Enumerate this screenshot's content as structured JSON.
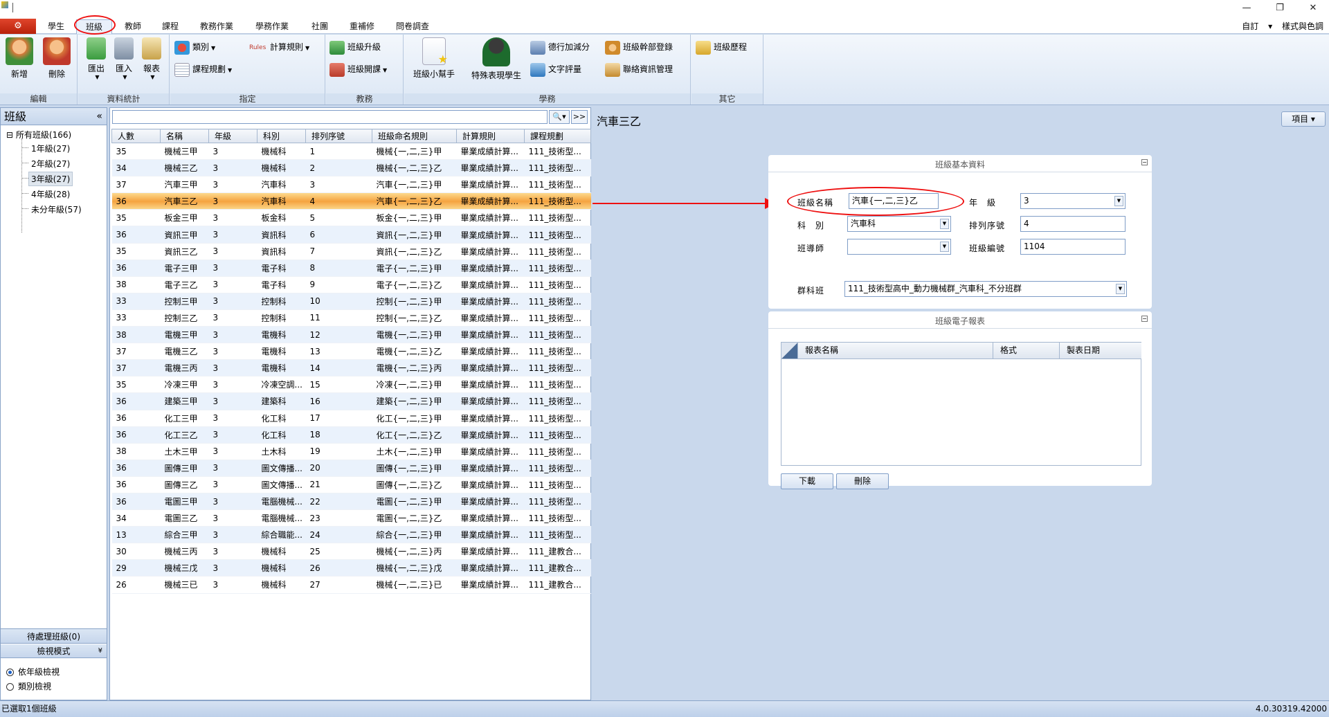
{
  "window": {
    "minimize": "—",
    "restore": "❐",
    "close": "✕"
  },
  "tabs": [
    {
      "label": "學生"
    },
    {
      "label": "班級"
    },
    {
      "label": "教師"
    },
    {
      "label": "課程"
    },
    {
      "label": "教務作業"
    },
    {
      "label": "學務作業"
    },
    {
      "label": "社團"
    },
    {
      "label": "重補修"
    },
    {
      "label": "問卷調查"
    }
  ],
  "top_right": {
    "customize": "自訂",
    "style": "樣式與色調"
  },
  "ribbon": {
    "groups": [
      {
        "label": "編輯"
      },
      {
        "label": "資料統計"
      },
      {
        "label": "指定"
      },
      {
        "label": "教務"
      },
      {
        "label": "學務"
      },
      {
        "label": "其它"
      }
    ],
    "add": "新增",
    "delete": "刪除",
    "export": "匯出",
    "import": "匯入",
    "report": "報表",
    "category": "類別",
    "calc_rule": "計算規則",
    "course_plan": "課程規劃",
    "upgrade": "班級升級",
    "open_course": "班級開課",
    "helper": "班級小幫手",
    "special": "特殊表現學生",
    "merit": "德行加減分",
    "text_eval": "文字評量",
    "cadre": "班級幹部登錄",
    "contact": "聯絡資訊管理",
    "history": "班級歷程"
  },
  "left_panel": {
    "title": "班級",
    "collapse": "«",
    "tree_root": "所有班級(166)",
    "tree_items": [
      "1年級(27)",
      "2年級(27)",
      "3年級(27)",
      "4年級(28)",
      "未分年級(57)"
    ],
    "pending": "待處理班級(0)",
    "view_mode": "檢視模式",
    "view_mode_arrow": "¥",
    "radio_grade": "依年級檢視",
    "radio_category": "類別檢視"
  },
  "list": {
    "search_placeholder": "",
    "search_btn": "🔍▾",
    "expand_btn": ">>",
    "columns": [
      "人數",
      "名稱",
      "年級",
      "科別",
      "排列序號",
      "班級命名規則",
      "計算規則",
      "課程規劃"
    ],
    "rows": [
      [
        "35",
        "機械三甲",
        "3",
        "機械科",
        "1",
        "機械{一,二,三}甲",
        "畢業成績計算...",
        "111_技術型..."
      ],
      [
        "34",
        "機械三乙",
        "3",
        "機械科",
        "2",
        "機械{一,二,三}乙",
        "畢業成績計算...",
        "111_技術型..."
      ],
      [
        "37",
        "汽車三甲",
        "3",
        "汽車科",
        "3",
        "汽車{一,二,三}甲",
        "畢業成績計算...",
        "111_技術型..."
      ],
      [
        "36",
        "汽車三乙",
        "3",
        "汽車科",
        "4",
        "汽車{一,二,三}乙",
        "畢業成績計算...",
        "111_技術型..."
      ],
      [
        "35",
        "板金三甲",
        "3",
        "板金科",
        "5",
        "板金{一,二,三}甲",
        "畢業成績計算...",
        "111_技術型..."
      ],
      [
        "36",
        "資訊三甲",
        "3",
        "資訊科",
        "6",
        "資訊{一,二,三}甲",
        "畢業成績計算...",
        "111_技術型..."
      ],
      [
        "35",
        "資訊三乙",
        "3",
        "資訊科",
        "7",
        "資訊{一,二,三}乙",
        "畢業成績計算...",
        "111_技術型..."
      ],
      [
        "36",
        "電子三甲",
        "3",
        "電子科",
        "8",
        "電子{一,二,三}甲",
        "畢業成績計算...",
        "111_技術型..."
      ],
      [
        "38",
        "電子三乙",
        "3",
        "電子科",
        "9",
        "電子{一,二,三}乙",
        "畢業成績計算...",
        "111_技術型..."
      ],
      [
        "33",
        "控制三甲",
        "3",
        "控制科",
        "10",
        "控制{一,二,三}甲",
        "畢業成績計算...",
        "111_技術型..."
      ],
      [
        "33",
        "控制三乙",
        "3",
        "控制科",
        "11",
        "控制{一,二,三}乙",
        "畢業成績計算...",
        "111_技術型..."
      ],
      [
        "38",
        "電機三甲",
        "3",
        "電機科",
        "12",
        "電機{一,二,三}甲",
        "畢業成績計算...",
        "111_技術型..."
      ],
      [
        "37",
        "電機三乙",
        "3",
        "電機科",
        "13",
        "電機{一,二,三}乙",
        "畢業成績計算...",
        "111_技術型..."
      ],
      [
        "37",
        "電機三丙",
        "3",
        "電機科",
        "14",
        "電機{一,二,三}丙",
        "畢業成績計算...",
        "111_技術型..."
      ],
      [
        "35",
        "冷凍三甲",
        "3",
        "冷凍空調...",
        "15",
        "冷凍{一,二,三}甲",
        "畢業成績計算...",
        "111_技術型..."
      ],
      [
        "36",
        "建築三甲",
        "3",
        "建築科",
        "16",
        "建築{一,二,三}甲",
        "畢業成績計算...",
        "111_技術型..."
      ],
      [
        "36",
        "化工三甲",
        "3",
        "化工科",
        "17",
        "化工{一,二,三}甲",
        "畢業成績計算...",
        "111_技術型..."
      ],
      [
        "36",
        "化工三乙",
        "3",
        "化工科",
        "18",
        "化工{一,二,三}乙",
        "畢業成績計算...",
        "111_技術型..."
      ],
      [
        "38",
        "土木三甲",
        "3",
        "土木科",
        "19",
        "土木{一,二,三}甲",
        "畢業成績計算...",
        "111_技術型..."
      ],
      [
        "36",
        "圖傳三甲",
        "3",
        "圖文傳播...",
        "20",
        "圖傳{一,二,三}甲",
        "畢業成績計算...",
        "111_技術型..."
      ],
      [
        "36",
        "圖傳三乙",
        "3",
        "圖文傳播...",
        "21",
        "圖傳{一,二,三}乙",
        "畢業成績計算...",
        "111_技術型..."
      ],
      [
        "36",
        "電圖三甲",
        "3",
        "電腦機械...",
        "22",
        "電圖{一,二,三}甲",
        "畢業成績計算...",
        "111_技術型..."
      ],
      [
        "34",
        "電圖三乙",
        "3",
        "電腦機械...",
        "23",
        "電圖{一,二,三}乙",
        "畢業成績計算...",
        "111_技術型..."
      ],
      [
        "13",
        "綜合三甲",
        "3",
        "綜合職能...",
        "24",
        "綜合{一,二,三}甲",
        "畢業成績計算...",
        "111_技術型..."
      ],
      [
        "30",
        "機械三丙",
        "3",
        "機械科",
        "25",
        "機械{一,二,三}丙",
        "畢業成績計算...",
        "111_建教合..."
      ],
      [
        "29",
        "機械三戊",
        "3",
        "機械科",
        "26",
        "機械{一,二,三}戊",
        "畢業成績計算...",
        "111_建教合..."
      ],
      [
        "26",
        "機械三已",
        "3",
        "機械科",
        "27",
        "機械{一,二,三}已",
        "畢業成績計算...",
        "111_建教合..."
      ]
    ],
    "selected_index": 3
  },
  "detail": {
    "title": "汽車三乙",
    "items_btn": "項目",
    "basic": {
      "card_title": "班級基本資料",
      "name_label": "班級名稱",
      "name_value": "汽車{一,二,三}乙",
      "grade_label": "年　級",
      "grade_value": "3",
      "dept_label": "科　別",
      "dept_value": "汽車科",
      "order_label": "排列序號",
      "order_value": "4",
      "teacher_label": "班導師",
      "teacher_value": "",
      "code_label": "班級編號",
      "code_value": "1104",
      "group_label": "群科班",
      "group_value": "111_技術型高中_動力機械群_汽車科_不分班群"
    },
    "report": {
      "card_title": "班級電子報表",
      "col_name": "報表名稱",
      "col_format": "格式",
      "col_date": "製表日期",
      "download": "下載",
      "delete": "刪除"
    }
  },
  "status": {
    "left": "已選取1個班級",
    "right": "4.0.30319.42000"
  },
  "colors": {
    "accent_red": "#e11111",
    "selection": "#f5a340"
  }
}
